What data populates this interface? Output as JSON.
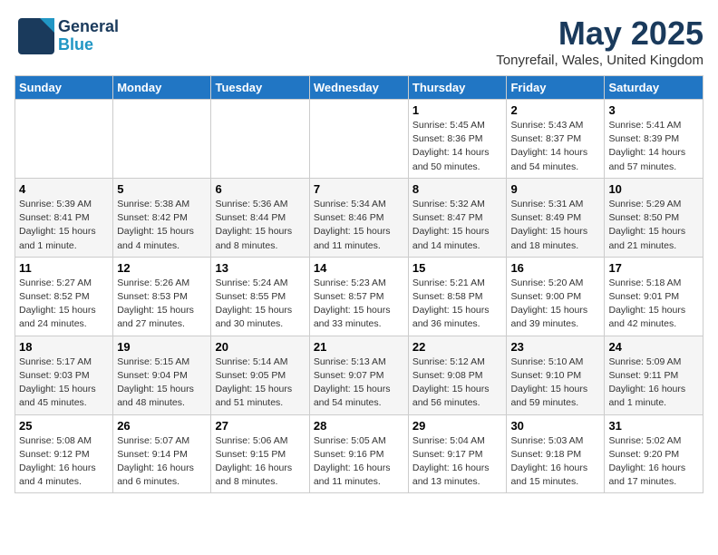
{
  "header": {
    "logo_general": "General",
    "logo_blue": "Blue",
    "month_title": "May 2025",
    "location": "Tonyrefail, Wales, United Kingdom"
  },
  "days_of_week": [
    "Sunday",
    "Monday",
    "Tuesday",
    "Wednesday",
    "Thursday",
    "Friday",
    "Saturday"
  ],
  "weeks": [
    [
      {
        "day": "",
        "info": ""
      },
      {
        "day": "",
        "info": ""
      },
      {
        "day": "",
        "info": ""
      },
      {
        "day": "",
        "info": ""
      },
      {
        "day": "1",
        "info": "Sunrise: 5:45 AM\nSunset: 8:36 PM\nDaylight: 14 hours\nand 50 minutes."
      },
      {
        "day": "2",
        "info": "Sunrise: 5:43 AM\nSunset: 8:37 PM\nDaylight: 14 hours\nand 54 minutes."
      },
      {
        "day": "3",
        "info": "Sunrise: 5:41 AM\nSunset: 8:39 PM\nDaylight: 14 hours\nand 57 minutes."
      }
    ],
    [
      {
        "day": "4",
        "info": "Sunrise: 5:39 AM\nSunset: 8:41 PM\nDaylight: 15 hours\nand 1 minute."
      },
      {
        "day": "5",
        "info": "Sunrise: 5:38 AM\nSunset: 8:42 PM\nDaylight: 15 hours\nand 4 minutes."
      },
      {
        "day": "6",
        "info": "Sunrise: 5:36 AM\nSunset: 8:44 PM\nDaylight: 15 hours\nand 8 minutes."
      },
      {
        "day": "7",
        "info": "Sunrise: 5:34 AM\nSunset: 8:46 PM\nDaylight: 15 hours\nand 11 minutes."
      },
      {
        "day": "8",
        "info": "Sunrise: 5:32 AM\nSunset: 8:47 PM\nDaylight: 15 hours\nand 14 minutes."
      },
      {
        "day": "9",
        "info": "Sunrise: 5:31 AM\nSunset: 8:49 PM\nDaylight: 15 hours\nand 18 minutes."
      },
      {
        "day": "10",
        "info": "Sunrise: 5:29 AM\nSunset: 8:50 PM\nDaylight: 15 hours\nand 21 minutes."
      }
    ],
    [
      {
        "day": "11",
        "info": "Sunrise: 5:27 AM\nSunset: 8:52 PM\nDaylight: 15 hours\nand 24 minutes."
      },
      {
        "day": "12",
        "info": "Sunrise: 5:26 AM\nSunset: 8:53 PM\nDaylight: 15 hours\nand 27 minutes."
      },
      {
        "day": "13",
        "info": "Sunrise: 5:24 AM\nSunset: 8:55 PM\nDaylight: 15 hours\nand 30 minutes."
      },
      {
        "day": "14",
        "info": "Sunrise: 5:23 AM\nSunset: 8:57 PM\nDaylight: 15 hours\nand 33 minutes."
      },
      {
        "day": "15",
        "info": "Sunrise: 5:21 AM\nSunset: 8:58 PM\nDaylight: 15 hours\nand 36 minutes."
      },
      {
        "day": "16",
        "info": "Sunrise: 5:20 AM\nSunset: 9:00 PM\nDaylight: 15 hours\nand 39 minutes."
      },
      {
        "day": "17",
        "info": "Sunrise: 5:18 AM\nSunset: 9:01 PM\nDaylight: 15 hours\nand 42 minutes."
      }
    ],
    [
      {
        "day": "18",
        "info": "Sunrise: 5:17 AM\nSunset: 9:03 PM\nDaylight: 15 hours\nand 45 minutes."
      },
      {
        "day": "19",
        "info": "Sunrise: 5:15 AM\nSunset: 9:04 PM\nDaylight: 15 hours\nand 48 minutes."
      },
      {
        "day": "20",
        "info": "Sunrise: 5:14 AM\nSunset: 9:05 PM\nDaylight: 15 hours\nand 51 minutes."
      },
      {
        "day": "21",
        "info": "Sunrise: 5:13 AM\nSunset: 9:07 PM\nDaylight: 15 hours\nand 54 minutes."
      },
      {
        "day": "22",
        "info": "Sunrise: 5:12 AM\nSunset: 9:08 PM\nDaylight: 15 hours\nand 56 minutes."
      },
      {
        "day": "23",
        "info": "Sunrise: 5:10 AM\nSunset: 9:10 PM\nDaylight: 15 hours\nand 59 minutes."
      },
      {
        "day": "24",
        "info": "Sunrise: 5:09 AM\nSunset: 9:11 PM\nDaylight: 16 hours\nand 1 minute."
      }
    ],
    [
      {
        "day": "25",
        "info": "Sunrise: 5:08 AM\nSunset: 9:12 PM\nDaylight: 16 hours\nand 4 minutes."
      },
      {
        "day": "26",
        "info": "Sunrise: 5:07 AM\nSunset: 9:14 PM\nDaylight: 16 hours\nand 6 minutes."
      },
      {
        "day": "27",
        "info": "Sunrise: 5:06 AM\nSunset: 9:15 PM\nDaylight: 16 hours\nand 8 minutes."
      },
      {
        "day": "28",
        "info": "Sunrise: 5:05 AM\nSunset: 9:16 PM\nDaylight: 16 hours\nand 11 minutes."
      },
      {
        "day": "29",
        "info": "Sunrise: 5:04 AM\nSunset: 9:17 PM\nDaylight: 16 hours\nand 13 minutes."
      },
      {
        "day": "30",
        "info": "Sunrise: 5:03 AM\nSunset: 9:18 PM\nDaylight: 16 hours\nand 15 minutes."
      },
      {
        "day": "31",
        "info": "Sunrise: 5:02 AM\nSunset: 9:20 PM\nDaylight: 16 hours\nand 17 minutes."
      }
    ]
  ]
}
